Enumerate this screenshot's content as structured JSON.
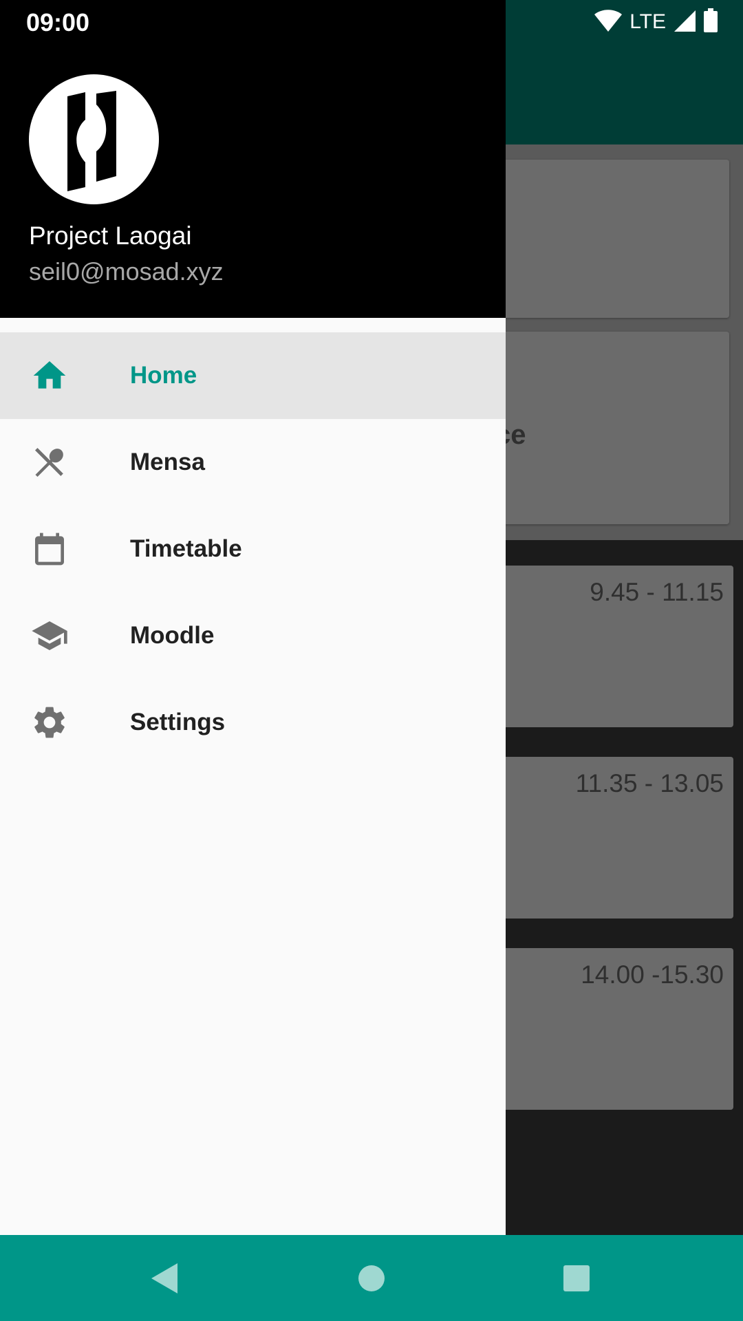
{
  "status_bar": {
    "time": "09:00",
    "network": "LTE"
  },
  "drawer": {
    "profile": {
      "name": "Project Laogai",
      "email": "seil0@mosad.xyz",
      "avatar": "logo-avatar"
    },
    "items": [
      {
        "label": "Home",
        "icon": "home-icon",
        "selected": true
      },
      {
        "label": "Mensa",
        "icon": "utensils-icon",
        "selected": false
      },
      {
        "label": "Timetable",
        "icon": "calendar-icon",
        "selected": false
      },
      {
        "label": "Moodle",
        "icon": "school-icon",
        "selected": false
      },
      {
        "label": "Settings",
        "icon": "gear-icon",
        "selected": false
      }
    ]
  },
  "background": {
    "card_partial_text": "ce",
    "lesson_times": [
      "9.45 - 11.15",
      "11.35 - 13.05",
      "14.00 -15.30"
    ]
  },
  "colors": {
    "accent": "#009688",
    "app_bar": "#004d40",
    "drawer_header": "#000000",
    "drawer_background": "#fafafa",
    "selected_item_background": "#e5e5e5"
  }
}
